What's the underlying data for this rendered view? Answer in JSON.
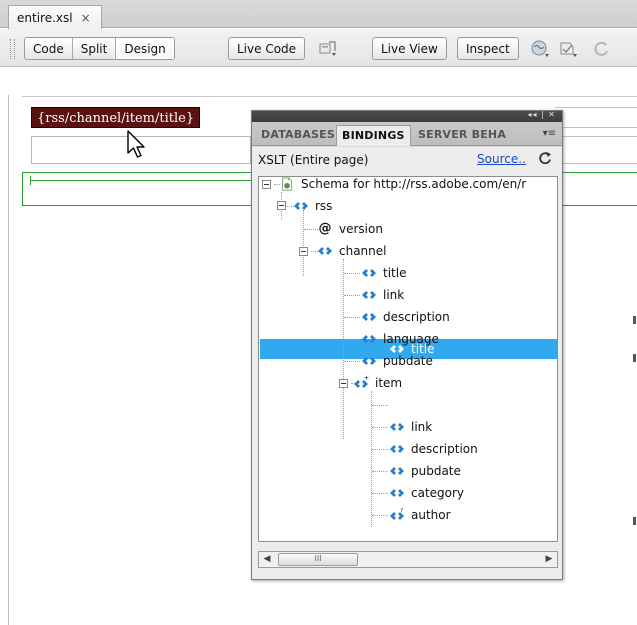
{
  "document_tab": {
    "label": "entire.xsl",
    "close": "×"
  },
  "toolbar": {
    "code": "Code",
    "split": "Split",
    "design": "Design",
    "live_code": "Live Code",
    "live_view": "Live View",
    "inspect": "Inspect"
  },
  "design_view": {
    "xslt_chip": "{rss/channel/item/title}"
  },
  "panel": {
    "tabs": [
      "DATABASES",
      "BINDINGS",
      "SERVER BEHA"
    ],
    "selected_tab": "BINDINGS",
    "window_controls": "◂◂ | ✕",
    "menu_icon": "▾≡",
    "source_label": "XSLT (Entire page)",
    "source_link": "Source..",
    "tree": {
      "root": "Schema for http://rss.adobe.com/en/r",
      "nodes": [
        {
          "label": "rss"
        },
        {
          "label": "version"
        },
        {
          "label": "channel"
        },
        {
          "label": "title"
        },
        {
          "label": "link"
        },
        {
          "label": "description"
        },
        {
          "label": "language"
        },
        {
          "label": "pubdate"
        },
        {
          "label": "item"
        },
        {
          "label": "title",
          "selected": true
        },
        {
          "label": "link"
        },
        {
          "label": "description"
        },
        {
          "label": "pubdate"
        },
        {
          "label": "category"
        },
        {
          "label": "author"
        }
      ]
    },
    "scroll_thumb_glyph": "III",
    "colors": {
      "selection": "#30a9ef",
      "element_icon": "#2a7fc8",
      "chip_bg": "#5b1212"
    }
  }
}
